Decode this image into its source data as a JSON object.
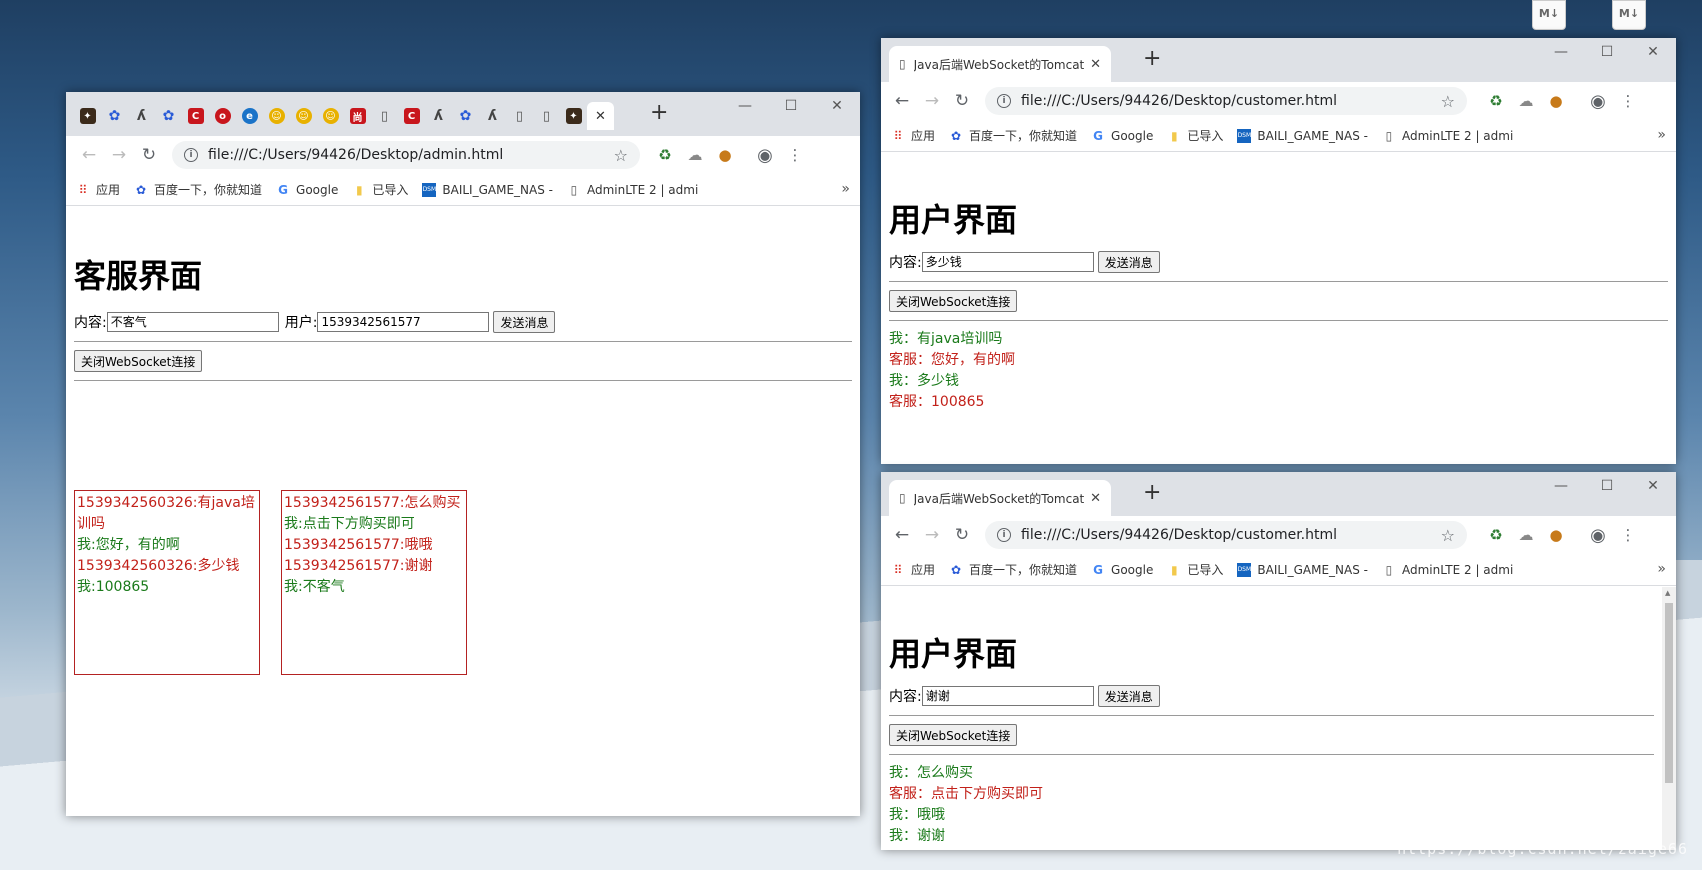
{
  "desktop": {
    "icons": [
      "M↓",
      "M↓"
    ],
    "watermark": "https://blog.csdn.net/zaige66"
  },
  "browser_common": {
    "bookmarks": [
      {
        "icon": "apps-grid-icon",
        "label": "应用"
      },
      {
        "icon": "baidu-paw-icon",
        "label": "百度一下，你就知道"
      },
      {
        "icon": "google-g-icon",
        "label": "Google"
      },
      {
        "icon": "folder-icon",
        "label": "已导入"
      },
      {
        "icon": "dsm-icon",
        "label": "BAILI_GAME_NAS -"
      },
      {
        "icon": "page-icon",
        "label": "AdminLTE 2 | admi"
      }
    ],
    "window_controls": [
      "—",
      "☐",
      "✕"
    ]
  },
  "admin_window": {
    "url": "file:///C:/Users/94426/Desktop/admin.html",
    "page_title": "客服界面",
    "content_label": "内容:",
    "content_value": "不客气",
    "user_label": "用户:",
    "user_value": "1539342561577",
    "send_label": "发送消息",
    "close_label": "关闭WebSocket连接",
    "chat_boxes": [
      [
        {
          "from": "cs",
          "text": "1539342560326:有java培训吗"
        },
        {
          "from": "me",
          "text": "我:您好，有的啊"
        },
        {
          "from": "cs",
          "text": "1539342560326:多少钱"
        },
        {
          "from": "me",
          "text": "我:100865"
        }
      ],
      [
        {
          "from": "cs",
          "text": "1539342561577:怎么购买"
        },
        {
          "from": "me",
          "text": "我:点击下方购买即可"
        },
        {
          "from": "cs",
          "text": "1539342561577:哦哦"
        },
        {
          "from": "cs",
          "text": "1539342561577:谢谢"
        },
        {
          "from": "me",
          "text": "我:不客气"
        }
      ]
    ]
  },
  "customer_window_1": {
    "tab_title": "Java后端WebSocket的Tomcat实",
    "url": "file:///C:/Users/94426/Desktop/customer.html",
    "page_title": "用户界面",
    "content_label": "内容:",
    "content_value": "多少钱",
    "send_label": "发送消息",
    "close_label": "关闭WebSocket连接",
    "messages": [
      {
        "from": "me",
        "text": "我：有java培训吗"
      },
      {
        "from": "cs",
        "text": "客服：您好，有的啊"
      },
      {
        "from": "me",
        "text": "我：多少钱"
      },
      {
        "from": "cs",
        "text": "客服：100865"
      }
    ]
  },
  "customer_window_2": {
    "tab_title": "Java后端WebSocket的Tomcat实",
    "url": "file:///C:/Users/94426/Desktop/customer.html",
    "page_title": "用户界面",
    "content_label": "内容:",
    "content_value": "谢谢",
    "send_label": "发送消息",
    "close_label": "关闭WebSocket连接",
    "messages": [
      {
        "from": "me",
        "text": "我：怎么购买"
      },
      {
        "from": "cs",
        "text": "客服：点击下方购买即可"
      },
      {
        "from": "me",
        "text": "我：哦哦"
      },
      {
        "from": "me",
        "text": "我：谢谢"
      }
    ]
  }
}
